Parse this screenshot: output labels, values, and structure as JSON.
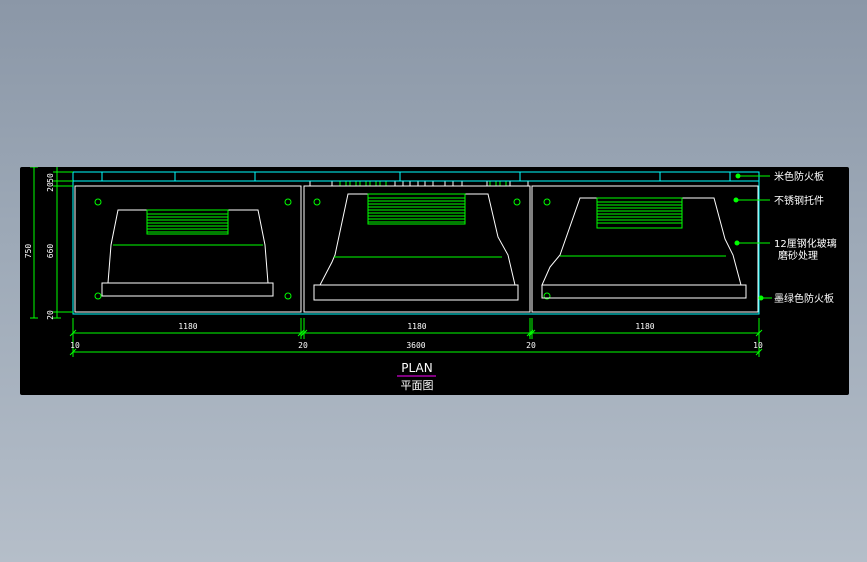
{
  "colors": {
    "background": "#000000",
    "outline": "#ffffff",
    "dimension": "#00ff00",
    "cyan": "#00ffff",
    "title_underline": "#ff00ff"
  },
  "dimensions": {
    "vertical_total": "750",
    "vertical_top": "20",
    "vertical_middle": "660",
    "vertical_bottom": "20",
    "vertical_small_top": "50",
    "panel_width_1": "1180",
    "panel_width_2": "1180",
    "panel_width_3": "1180",
    "total_width": "3600",
    "gap_left": "10",
    "gap_1": "20",
    "gap_2": "20",
    "gap_right": "10"
  },
  "callouts": [
    {
      "text": "米色防火板"
    },
    {
      "text": "不锈钢托件"
    },
    {
      "text": "12厘钢化玻璃"
    },
    {
      "text": "磨砂处理"
    },
    {
      "text": "墨绿色防火板"
    }
  ],
  "title": {
    "main": "PLAN",
    "sub": "平面图"
  }
}
